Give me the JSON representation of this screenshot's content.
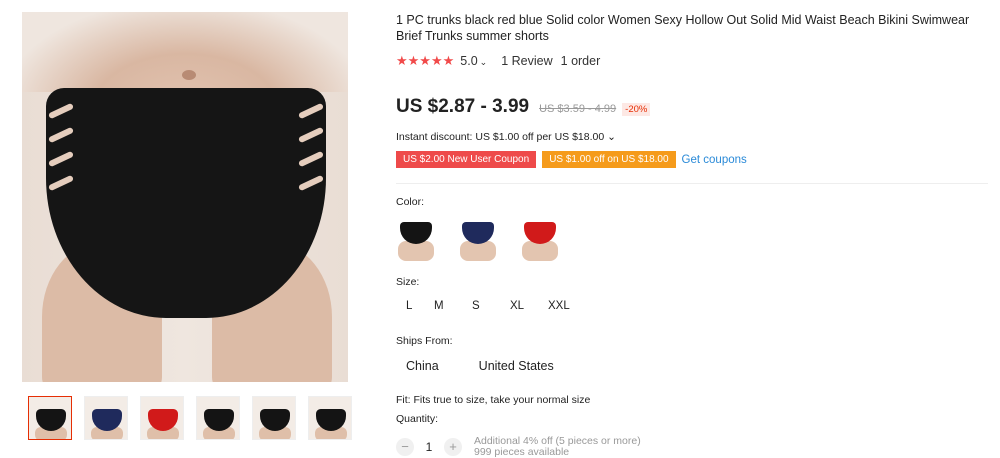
{
  "product": {
    "title": "1 PC trunks black red blue Solid color Women Sexy Hollow Out Solid Mid Waist Beach Bikini Swimwear Brief Trunks summer shorts",
    "rating_stars": "★★★★★",
    "rating_score": "5.0",
    "reviews": "1 Review",
    "orders": "1 order"
  },
  "price": {
    "current": "US $2.87 - 3.99",
    "original": "US $3.59 - 4.99",
    "discount": "-20%"
  },
  "promo": {
    "instant": "Instant discount: US $1.00 off per US $18.00",
    "coupon_new_user": "US $2.00 New User Coupon",
    "coupon_store": "US $1.00 off on US $18.00",
    "get_coupons": "Get coupons"
  },
  "options": {
    "color_label": "Color:",
    "colors": [
      "#141414",
      "#1f2a5c",
      "#d11a1a"
    ],
    "size_label": "Size:",
    "sizes": [
      "L",
      "M",
      "S",
      "XL",
      "XXL"
    ],
    "ships_label": "Ships From:",
    "ships": [
      "China",
      "United States"
    ],
    "fit": "Fit: Fits true to size, take your normal size",
    "quantity_label": "Quantity:",
    "quantity": "1",
    "quantity_minus": "−",
    "quantity_plus": "+",
    "additional_discount": "Additional 4% off (5 pieces or more)",
    "available": "999 pieces available"
  },
  "gallery": {
    "thumb_colors": [
      "#141414",
      "#1f2a5c",
      "#d11a1a",
      "#141414",
      "#141414",
      "#141414"
    ]
  }
}
